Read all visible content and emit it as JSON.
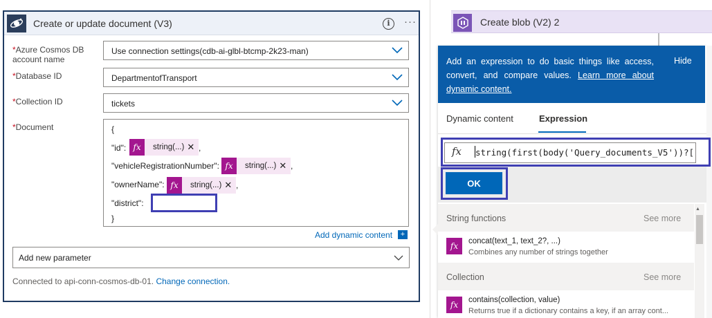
{
  "action_card": {
    "title": "Create or update document (V3)",
    "more_label": "···",
    "fields": {
      "account": {
        "label": "Azure Cosmos DB account name",
        "value": "Use connection settings(cdb-ai-glbl-btcmp-2k23-man)"
      },
      "database": {
        "label": "Database ID",
        "value": "DepartmentofTransport"
      },
      "collection": {
        "label": "Collection ID",
        "value": "tickets"
      },
      "document": {
        "label": "Document",
        "open_brace": "{",
        "close_brace": "}",
        "lines": [
          {
            "key": "\"id\":",
            "token": "string(...)"
          },
          {
            "key": "\"vehicleRegistrationNumber\":",
            "token": "string(...)"
          },
          {
            "key": "\"ownerName\":",
            "token": "string(...)"
          },
          {
            "key": "\"district\":",
            "token": ""
          }
        ]
      }
    },
    "add_dynamic_content": "Add dynamic content",
    "add_new_parameter": "Add new parameter",
    "connected_text": "Connected to api-conn-cosmos-db-01.",
    "change_connection": "Change connection."
  },
  "blob_card": {
    "title": "Create blob (V2) 2"
  },
  "expression_panel": {
    "info_text": "Add an expression to do basic things like access, convert, and compare values.",
    "learn_more": "Learn more about dynamic content.",
    "hide_label": "Hide",
    "tabs": [
      {
        "label": "Dynamic content",
        "active": false
      },
      {
        "label": "Expression",
        "active": true
      }
    ],
    "expression_value": "string(first(body('Query_documents_V5'))?[",
    "ok_label": "OK",
    "sections": [
      {
        "title": "String functions",
        "see_more": "See more",
        "functions": [
          {
            "name": "concat(text_1, text_2?, ...)",
            "description": "Combines any number of strings together"
          }
        ]
      },
      {
        "title": "Collection",
        "see_more": "See more",
        "functions": [
          {
            "name": "contains(collection, value)",
            "description": "Returns true if a dictionary contains a key, if an array cont..."
          }
        ]
      }
    ]
  },
  "colors": {
    "accent": "#0067b8",
    "panel_header": "#0a5ca8",
    "expression_token": "#a3168f",
    "highlight_border": "#3f3fb3",
    "required": "#c50f1f"
  },
  "icons": {
    "connector": "cosmos-db-icon",
    "blob": "blob-storage-icon",
    "fx": "fx-icon"
  }
}
